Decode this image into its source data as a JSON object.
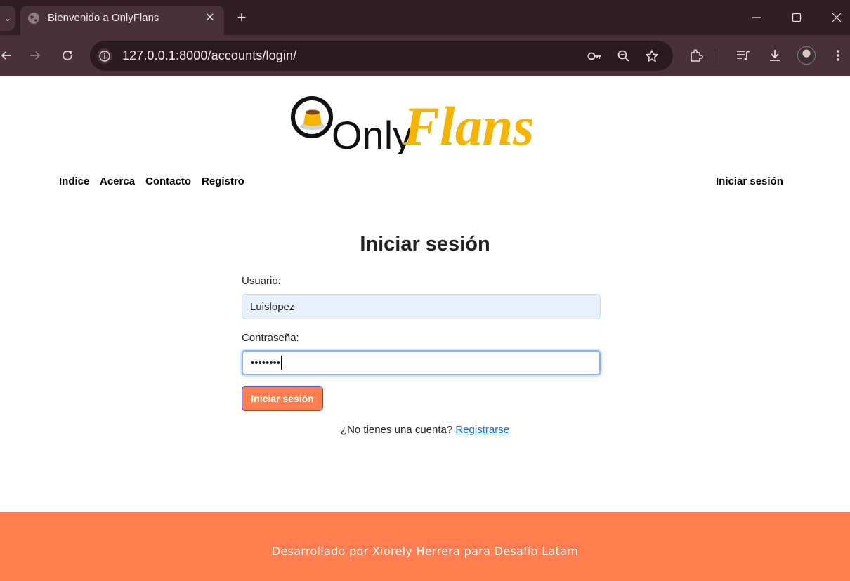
{
  "browser": {
    "tab_title": "Bienvenido a OnlyFlans",
    "url": "127.0.0.1:8000/accounts/login/",
    "icons": [
      "tab-list-icon",
      "globe-icon",
      "close-icon",
      "plus-icon",
      "minimize-icon",
      "maximize-icon",
      "window-close-icon",
      "back-icon",
      "forward-icon",
      "reload-icon",
      "info-icon",
      "key-icon",
      "zoom-icon",
      "star-icon",
      "extensions-icon",
      "media-icon",
      "download-icon",
      "profile-avatar",
      "more-icon"
    ]
  },
  "logo": {
    "part1": "Only",
    "part2": "Flans",
    "colors": {
      "dark": "#111111",
      "accent": "#f5b400"
    }
  },
  "nav": {
    "items": [
      {
        "label": "Indice"
      },
      {
        "label": "Acerca"
      },
      {
        "label": "Contacto"
      },
      {
        "label": "Registro"
      }
    ],
    "login": "Iniciar sesión"
  },
  "form": {
    "title": "Iniciar sesión",
    "username_label": "Usuario:",
    "username_value": "Luislopez",
    "password_label": "Contraseña:",
    "password_value": "••••••••",
    "submit_label": "Iniciar sesión",
    "signup_prompt": "¿No tienes una cuenta?",
    "signup_link": "Registrarse"
  },
  "footer": {
    "text": "Desarrollado por Xiorely Herrera para Desafío Latam"
  },
  "colors": {
    "chrome_dark": "#321d24",
    "chrome_toolbar": "#4a3038",
    "brand_orange": "#ff7d4e",
    "link_blue": "#1a6fd6"
  }
}
